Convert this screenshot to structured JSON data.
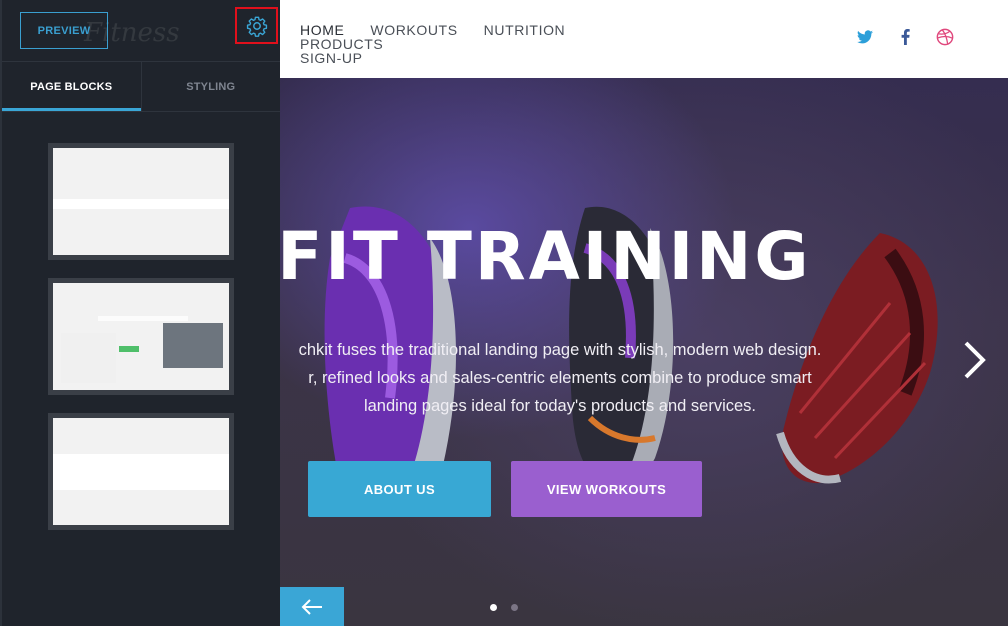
{
  "site": {
    "nav": [
      "HOME",
      "WORKOUTS",
      "NUTRITION",
      "PRODUCTS",
      "SIGN-UP"
    ],
    "social_icons": [
      "twitter-icon",
      "facebook-icon",
      "dribbble-icon"
    ],
    "hero": {
      "title": "OSSFIT TRAINING",
      "text_line1": "chkit fuses the traditional landing page with stylish, modern web design.",
      "text_line2": "r, refined looks and sales-centric elements combine to produce smart",
      "text_line3": "landing pages ideal for today's products and services.",
      "about_button": "ABOUT US",
      "workouts_button": "VIEW WORKOUTS"
    },
    "slider_dots": 2,
    "active_dot": 0
  },
  "panel": {
    "preview_label": "PREVIEW",
    "tabs": [
      "PAGE BLOCKS",
      "STYLING"
    ],
    "active_tab": "PAGE BLOCKS",
    "logo_ghost": "Fitness"
  },
  "colors": {
    "accent_blue": "#38a8d4",
    "accent_purple": "#9a5fcf",
    "panel_bg": "#1f242c",
    "highlight_red": "#e0101c"
  }
}
